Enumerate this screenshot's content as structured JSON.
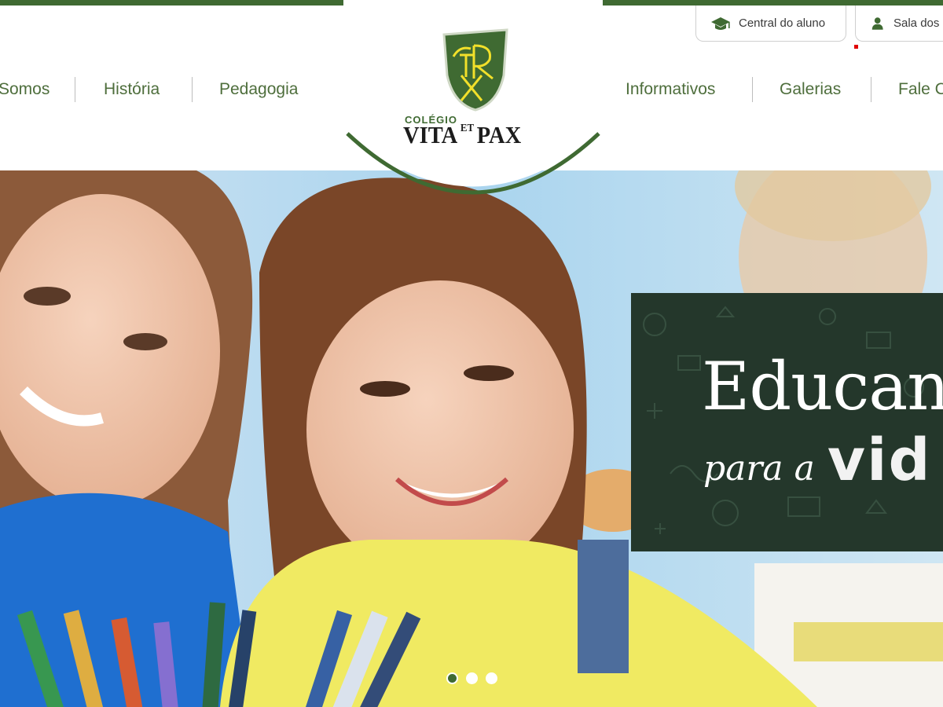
{
  "header": {
    "utility_tabs": [
      {
        "label": "Central do aluno",
        "icon": "graduation-cap-icon"
      },
      {
        "label": "Sala dos P",
        "icon": "user-icon"
      }
    ],
    "nav_left": [
      "Somos",
      "História",
      "Pedagogia"
    ],
    "nav_right": [
      "Informativos",
      "Galerias",
      "Fale C"
    ]
  },
  "logo": {
    "small_text": "COLÉGIO",
    "name_part1": "VITA",
    "name_sup": "ET",
    "name_part2": "PAX",
    "monogram": "CRUX"
  },
  "banner": {
    "title": "Educand",
    "subtitle_script": "para a",
    "subtitle_bold": "vid"
  },
  "slider": {
    "dot_count": 3,
    "active_index": 0
  },
  "colors": {
    "brand_green": "#3f6a32",
    "nav_text": "#4e6e3c",
    "banner_bg": "#24372b"
  }
}
